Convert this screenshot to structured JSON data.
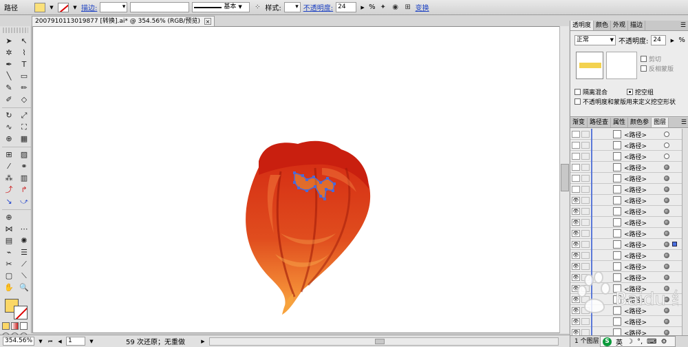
{
  "control_bar": {
    "object_type": "路径",
    "stroke_label": "描边:",
    "brush_label": "基本",
    "style_label": "样式:",
    "opacity_label": "不透明度:",
    "opacity_value": "24",
    "percent": "%",
    "transform_label": "变换",
    "fill_color": "#fbe17a"
  },
  "document_tab": {
    "title": "2007910113019877 [转换].ai* @ 354.56% (RGB/预览)",
    "close": "×"
  },
  "status_bar": {
    "zoom": "354.56%",
    "page": "1",
    "undo_text": "59 次还原；无重做"
  },
  "transparency_panel": {
    "tabs": [
      "透明度",
      "颜色",
      "外观",
      "描边"
    ],
    "blend_mode": "正常",
    "opacity_label": "不透明度:",
    "opacity_value": "24",
    "percent": "%",
    "clip_label": "剪切",
    "invert_mask_label": "反相蒙版",
    "isolate_label": "隔离混合",
    "knockout_label": "挖空组",
    "define_knockout_label": "不透明度和蒙版用来定义挖空形状"
  },
  "layers_panel": {
    "tabs": [
      "渐变",
      "路径查",
      "属性",
      "颜色参",
      "图层"
    ],
    "footer_text": "1 个图层",
    "rows": [
      {
        "name": "<路径>",
        "visible": false,
        "targeted": false,
        "selected": false
      },
      {
        "name": "<路径>",
        "visible": false,
        "targeted": false,
        "selected": false
      },
      {
        "name": "<路径>",
        "visible": false,
        "targeted": false,
        "selected": false
      },
      {
        "name": "<路径>",
        "visible": false,
        "targeted": true,
        "selected": false
      },
      {
        "name": "<路径>",
        "visible": false,
        "targeted": true,
        "selected": false
      },
      {
        "name": "<路径>",
        "visible": false,
        "targeted": true,
        "selected": false
      },
      {
        "name": "<路径>",
        "visible": true,
        "targeted": true,
        "selected": false
      },
      {
        "name": "<路径>",
        "visible": true,
        "targeted": true,
        "selected": false
      },
      {
        "name": "<路径>",
        "visible": true,
        "targeted": true,
        "selected": false
      },
      {
        "name": "<路径>",
        "visible": true,
        "targeted": true,
        "selected": false
      },
      {
        "name": "<路径>",
        "visible": true,
        "targeted": true,
        "selected": true
      },
      {
        "name": "<路径>",
        "visible": true,
        "targeted": true,
        "selected": false
      },
      {
        "name": "<路径>",
        "visible": true,
        "targeted": true,
        "selected": false
      },
      {
        "name": "<路径>",
        "visible": true,
        "targeted": true,
        "selected": false
      },
      {
        "name": "<路径>",
        "visible": true,
        "targeted": true,
        "selected": false
      },
      {
        "name": "<路径>",
        "visible": true,
        "targeted": true,
        "selected": false
      },
      {
        "name": "<路径>",
        "visible": true,
        "targeted": true,
        "selected": false
      },
      {
        "name": "<路径>",
        "visible": true,
        "targeted": true,
        "selected": false
      },
      {
        "name": "<路径>",
        "visible": true,
        "targeted": true,
        "selected": false
      }
    ]
  },
  "ime": {
    "logo": "S",
    "lang": "英"
  },
  "watermark_text": "Baidu 经验"
}
